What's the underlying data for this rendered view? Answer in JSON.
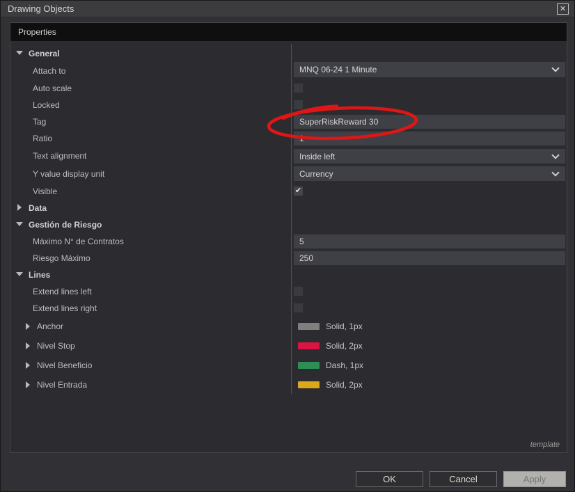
{
  "window": {
    "title": "Drawing Objects"
  },
  "icons": {
    "close": "✕",
    "check": "✔"
  },
  "panel": {
    "header": "Properties",
    "footer_note": "template"
  },
  "general": {
    "label": "General",
    "attach_to": {
      "label": "Attach to",
      "value": "MNQ 06-24 1 Minute"
    },
    "auto_scale": {
      "label": "Auto scale",
      "checked": false
    },
    "locked": {
      "label": "Locked",
      "checked": false
    },
    "tag": {
      "label": "Tag",
      "value": "SuperRiskReward 30"
    },
    "ratio": {
      "label": "Ratio",
      "value": "1"
    },
    "text_alignment": {
      "label": "Text alignment",
      "value": "Inside left"
    },
    "y_value_display_unit": {
      "label": "Y value display unit",
      "value": "Currency"
    },
    "visible": {
      "label": "Visible",
      "checked": true
    }
  },
  "data_group": {
    "label": "Data"
  },
  "gestion": {
    "label": "Gestión de Riesgo",
    "max_contratos": {
      "label": "Máximo N° de Contratos",
      "value": "5"
    },
    "riesgo_maximo": {
      "label": "Riesgo Máximo",
      "value": "250"
    }
  },
  "lines": {
    "label": "Lines",
    "extend_left": {
      "label": "Extend lines left",
      "checked": false
    },
    "extend_right": {
      "label": "Extend lines right",
      "checked": false
    },
    "anchor": {
      "label": "Anchor",
      "style": "Solid, 1px",
      "color": "#7f7f7f"
    },
    "nivel_stop": {
      "label": "Nivel Stop",
      "style": "Solid, 2px",
      "color": "#dc1441"
    },
    "nivel_beneficio": {
      "label": "Nivel Beneficio",
      "style": "Dash, 1px",
      "color": "#2e8f56"
    },
    "nivel_entrada": {
      "label": "Nivel Entrada",
      "style": "Solid, 2px",
      "color": "#dda71c"
    }
  },
  "annotation": {
    "color": "#e01616",
    "meaning": "red ellipse circling tag value"
  },
  "buttons": {
    "ok": "OK",
    "cancel": "Cancel",
    "apply": "Apply"
  }
}
